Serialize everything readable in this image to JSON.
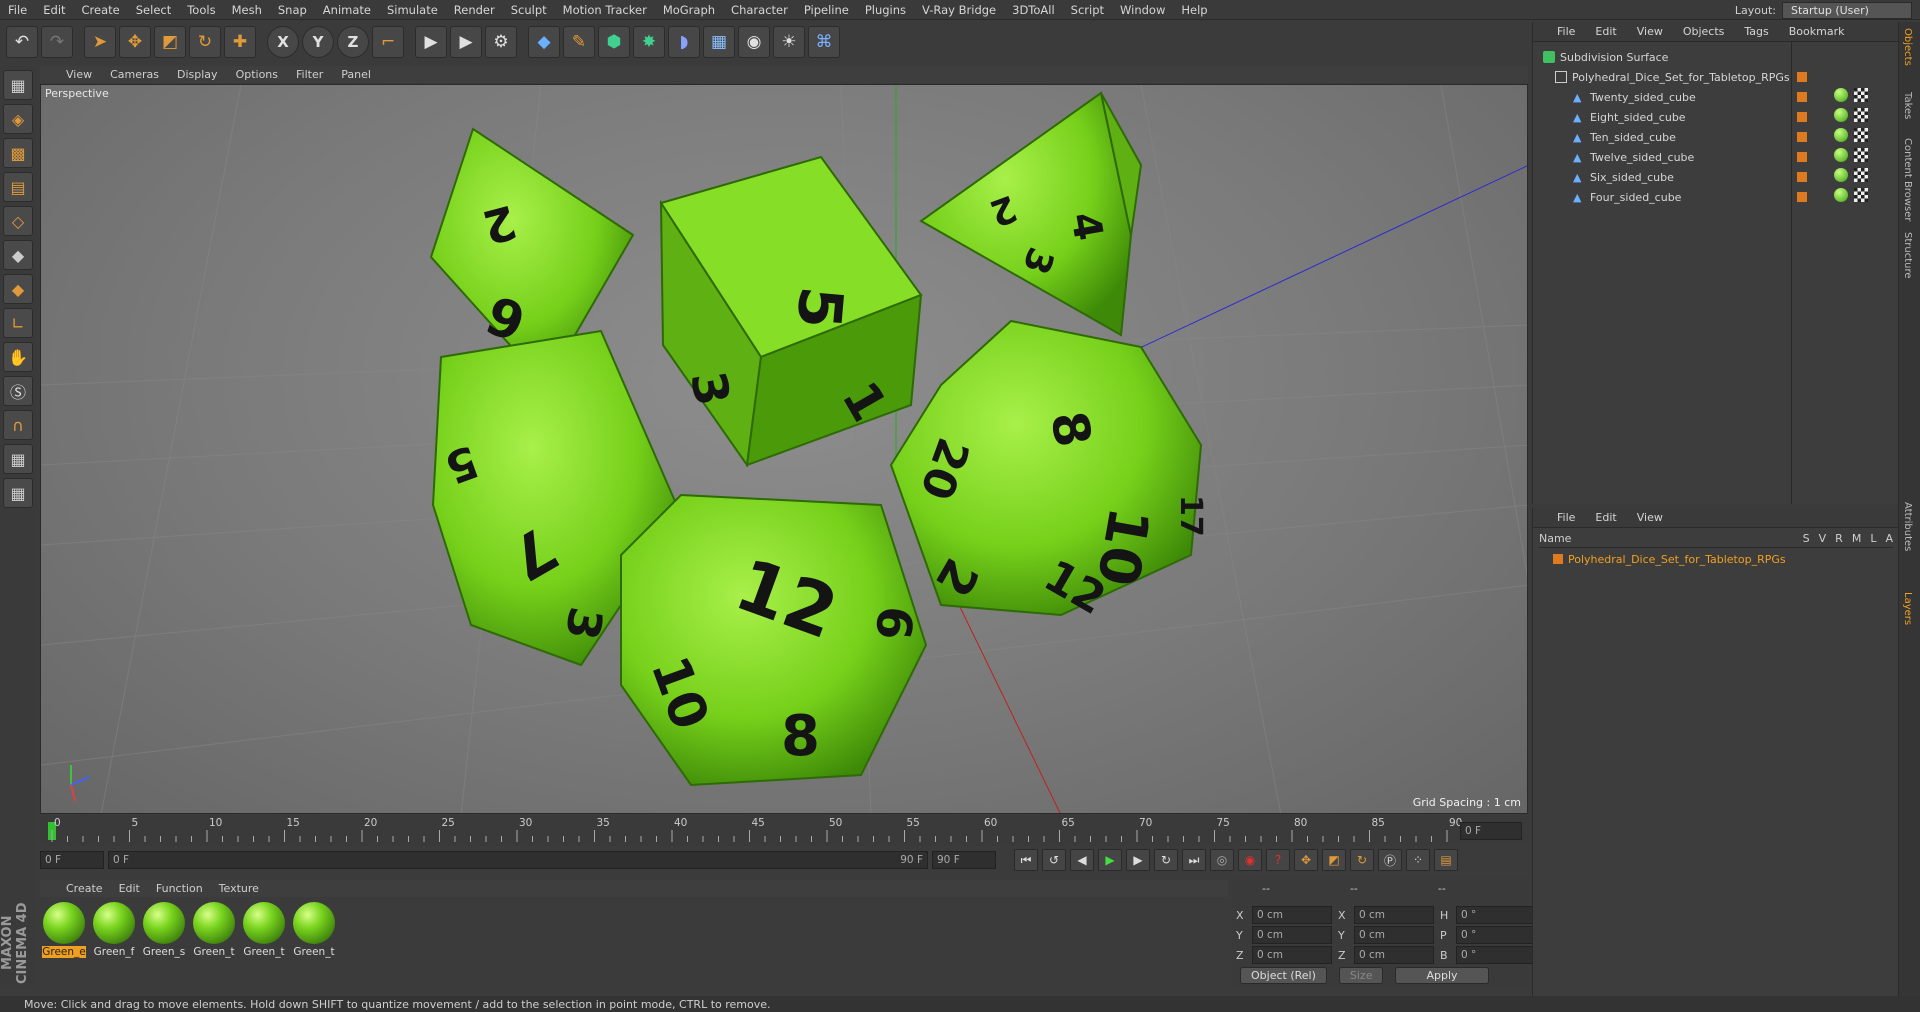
{
  "menubar": {
    "items": [
      "File",
      "Edit",
      "Create",
      "Select",
      "Tools",
      "Mesh",
      "Snap",
      "Animate",
      "Simulate",
      "Render",
      "Sculpt",
      "Motion Tracker",
      "MoGraph",
      "Character",
      "Pipeline",
      "Plugins",
      "V-Ray Bridge",
      "3DToAll",
      "Script",
      "Window",
      "Help"
    ],
    "layout_label": "Layout:",
    "layout_value": "Startup (User)"
  },
  "toolbar": {
    "axis_x": "X",
    "axis_y": "Y",
    "axis_z": "Z"
  },
  "viewport": {
    "menu": [
      "View",
      "Cameras",
      "Display",
      "Options",
      "Filter",
      "Panel"
    ],
    "label": "Perspective",
    "grid_spacing": "Grid Spacing : 1 cm",
    "dice": {
      "d8_a": [
        "2",
        "6"
      ],
      "d6": [
        "5",
        "3",
        "1"
      ],
      "d4": [
        "4",
        "2",
        "3"
      ],
      "d10": [
        "5",
        "7",
        "3"
      ],
      "d12": [
        "12",
        "10",
        "6",
        "8"
      ],
      "d20": [
        "8",
        "20",
        "10",
        "2",
        "12",
        "17"
      ]
    }
  },
  "timeline": {
    "ticks": [
      "0",
      "5",
      "10",
      "15",
      "20",
      "25",
      "30",
      "35",
      "40",
      "45",
      "50",
      "55",
      "60",
      "65",
      "70",
      "75",
      "80",
      "85",
      "90"
    ],
    "current_frame": "0 F",
    "start_field": "0 F",
    "range_start": "0 F",
    "range_end": "90 F",
    "end_field": "90 F"
  },
  "material_manager": {
    "menu": [
      "Create",
      "Edit",
      "Function",
      "Texture"
    ],
    "materials": [
      "Green_e",
      "Green_f",
      "Green_s",
      "Green_t",
      "Green_t",
      "Green_t"
    ]
  },
  "coordinates": {
    "header": [
      "--",
      "--",
      "--"
    ],
    "rows": [
      {
        "a": "X",
        "av": "0 cm",
        "b": "X",
        "bv": "0 cm",
        "c": "H",
        "cv": "0 °"
      },
      {
        "a": "Y",
        "av": "0 cm",
        "b": "Y",
        "bv": "0 cm",
        "c": "P",
        "cv": "0 °"
      },
      {
        "a": "Z",
        "av": "0 cm",
        "b": "Z",
        "bv": "0 cm",
        "c": "B",
        "cv": "0 °"
      }
    ],
    "mode": "Object (Rel)",
    "size": "Size",
    "apply": "Apply"
  },
  "object_manager": {
    "menu": [
      "File",
      "Edit",
      "View",
      "Objects",
      "Tags",
      "Bookmark"
    ],
    "objects": [
      "Subdivision Surface",
      "Polyhedral_Dice_Set_for_Tabletop_RPGs",
      "Twenty_sided_cube",
      "Eight_sided_cube",
      "Ten_sided_cube",
      "Twelve_sided_cube",
      "Six_sided_cube",
      "Four_sided_cube"
    ]
  },
  "layer_manager": {
    "menu": [
      "File",
      "Edit",
      "View"
    ],
    "name_col": "Name",
    "cols": [
      "S",
      "V",
      "R",
      "M",
      "L",
      "A"
    ],
    "layer": "Polyhedral_Dice_Set_for_Tabletop_RPGs"
  },
  "right_tabs": [
    "Objects",
    "Takes",
    "Content Browser",
    "Structure",
    "Attributes",
    "Layers"
  ],
  "status": "Move: Click and drag to move elements. Hold down SHIFT to quantize movement / add to the selection in point mode, CTRL to remove.",
  "brand": "MAXON CINEMA 4D",
  "colors": {
    "dice": "#7ad61c",
    "accent": "#f0a020"
  }
}
